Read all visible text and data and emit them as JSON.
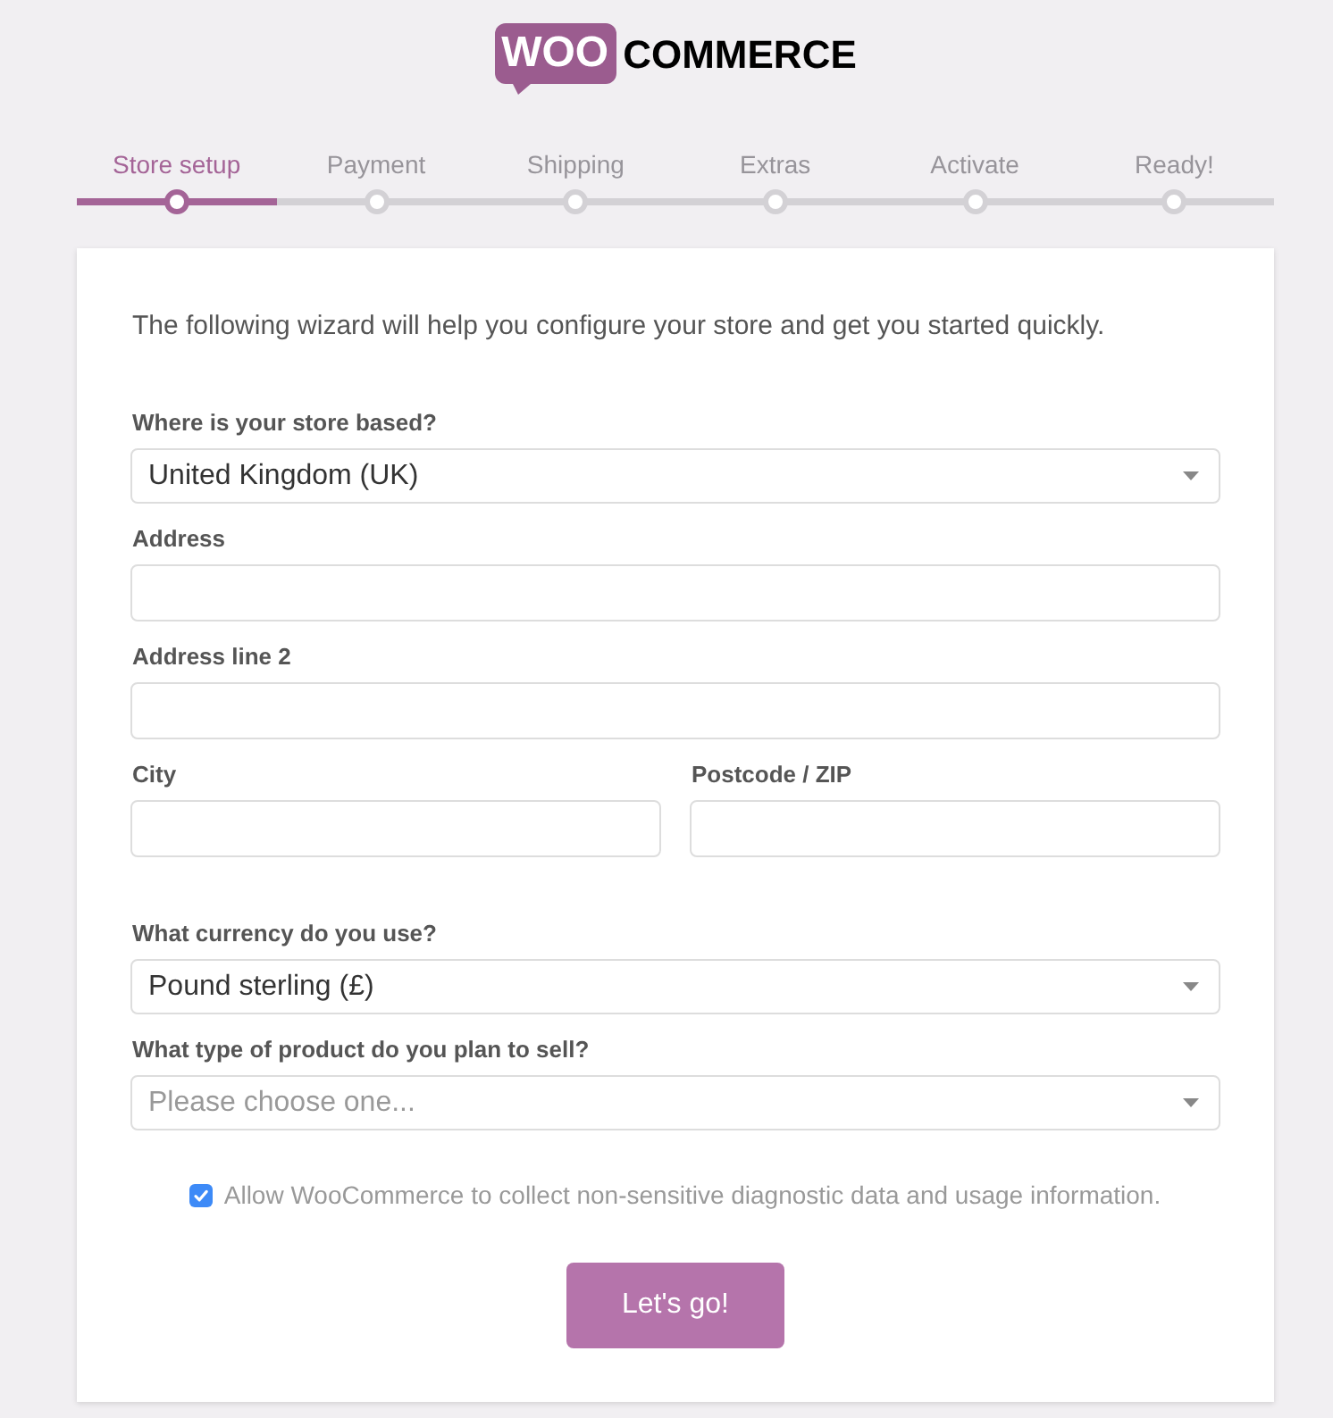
{
  "logo": {
    "badge": "WOO",
    "wordmark": "COMMERCE"
  },
  "steps": [
    {
      "label": "Store setup",
      "selected": true
    },
    {
      "label": "Payment",
      "selected": false
    },
    {
      "label": "Shipping",
      "selected": false
    },
    {
      "label": "Extras",
      "selected": false
    },
    {
      "label": "Activate",
      "selected": false
    },
    {
      "label": "Ready!",
      "selected": false
    }
  ],
  "intro": "The following wizard will help you configure your store and get you started quickly.",
  "sections": [
    {
      "fields": [
        {
          "kind": "select",
          "label": "Where is your store based?",
          "value": "United Kingdom (UK)"
        },
        {
          "kind": "text",
          "label": "Address"
        },
        {
          "kind": "text",
          "label": "Address line 2"
        },
        {
          "kind": "row",
          "fields": [
            {
              "kind": "text",
              "label": "City"
            },
            {
              "kind": "text",
              "label": "Postcode / ZIP"
            }
          ]
        }
      ]
    },
    {
      "fields": [
        {
          "kind": "select",
          "label": "What currency do you use?",
          "value": "Pound sterling (£)"
        },
        {
          "kind": "select",
          "label": "What type of product do you plan to sell?",
          "placeholder": "Please choose one..."
        }
      ]
    }
  ],
  "consent": {
    "label": "Allow WooCommerce to collect non-sensitive diagnostic data and usage information.",
    "checked": true
  },
  "submit_button": {
    "label": "Let's go!"
  }
}
